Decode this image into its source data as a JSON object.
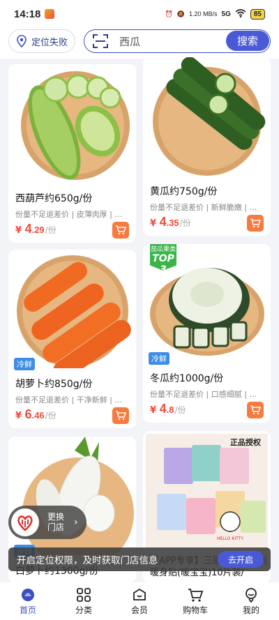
{
  "status": {
    "time": "14:18",
    "speed": "1.20 MB/s",
    "network": "5G",
    "battery": "85"
  },
  "header": {
    "location_label": "定位失败",
    "search_value": "西瓜",
    "search_button": "搜索"
  },
  "products": [
    {
      "name": "西葫芦约650g/份",
      "desc": "份量不足退差价 | 皮薄肉厚 | 荤素皆宜",
      "price_int": "4",
      "price_dec": ".29",
      "unit": "/份",
      "tag": ""
    },
    {
      "name": "黄瓜约750g/份",
      "desc": "份量不足退差价 | 新鲜脆嫩 | 清爽可口",
      "price_int": "4",
      "price_dec": ".35",
      "unit": "/份",
      "tag": ""
    },
    {
      "name": "胡萝卜约850g/份",
      "desc": "份量不足退差价 | 干净新鲜 | 自然甜",
      "price_int": "6",
      "price_dec": ".46",
      "unit": "/份",
      "tag": "冷鲜"
    },
    {
      "name": "冬瓜约1000g/份",
      "desc": "份量不足退差价 | 口感细腻 | 肉质厚实",
      "price_int": "4",
      "price_dec": ".8",
      "unit": "/份",
      "tag": "冷鲜",
      "rank_title": "茄瓜果类",
      "rank": "TOP 3"
    },
    {
      "name": "白萝卜约1300g/份",
      "tag": "冷鲜"
    },
    {
      "name": "【APP专享】三丽鸥授权系列暖身贴(暖宝宝)10片装/",
      "badge": "正品授权",
      "brand": "HELLO KITTY"
    }
  ],
  "store_switch": {
    "label": "更换门店"
  },
  "location_bar": {
    "text": "开启定位权限，及时获取门店信息",
    "button": "去开启"
  },
  "nav": [
    {
      "label": "首页",
      "icon": "home-icon"
    },
    {
      "label": "分类",
      "icon": "category-icon"
    },
    {
      "label": "会员",
      "icon": "member-icon"
    },
    {
      "label": "购物车",
      "icon": "cart-icon"
    },
    {
      "label": "我的",
      "icon": "profile-icon"
    }
  ],
  "colors": {
    "accent": "#4a5ad6",
    "price": "#f04b3a",
    "cart": "#f77a3e",
    "fresh_tag": "#3d8de6"
  }
}
